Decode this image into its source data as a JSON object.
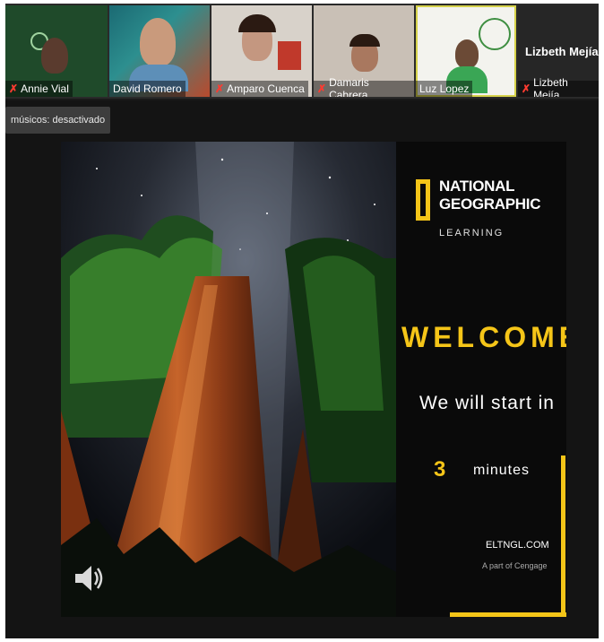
{
  "participants": [
    {
      "name": "Annie Vial",
      "muted": true
    },
    {
      "name": "David Romero",
      "muted": false
    },
    {
      "name": "Amparo Cuenca",
      "muted": true
    },
    {
      "name": "Damaris Cabrera",
      "muted": true
    },
    {
      "name": "Luz Lopez",
      "muted": false
    },
    {
      "name": "Lizbeth Mejía",
      "muted": true
    }
  ],
  "lizbeth_tile": {
    "display_name": "Lizbeth Mejía"
  },
  "banner": {
    "text": "músicos: desactivado"
  },
  "slide": {
    "logo_line1": "NATIONAL",
    "logo_line2": "GEOGRAPHIC",
    "logo_sub": "LEARNING",
    "welcome": "WELCOME!",
    "start_text": "We will start in",
    "minutes_number": "3",
    "minutes_word": "minutes",
    "website": "ELTNGL.COM",
    "tagline": "A part of Cengage"
  },
  "colors": {
    "accent_yellow": "#f5c518",
    "mic_off_red": "#ff3b30"
  },
  "icons": {
    "speaker": "speaker-icon",
    "mic_off": "mic-off-icon"
  }
}
